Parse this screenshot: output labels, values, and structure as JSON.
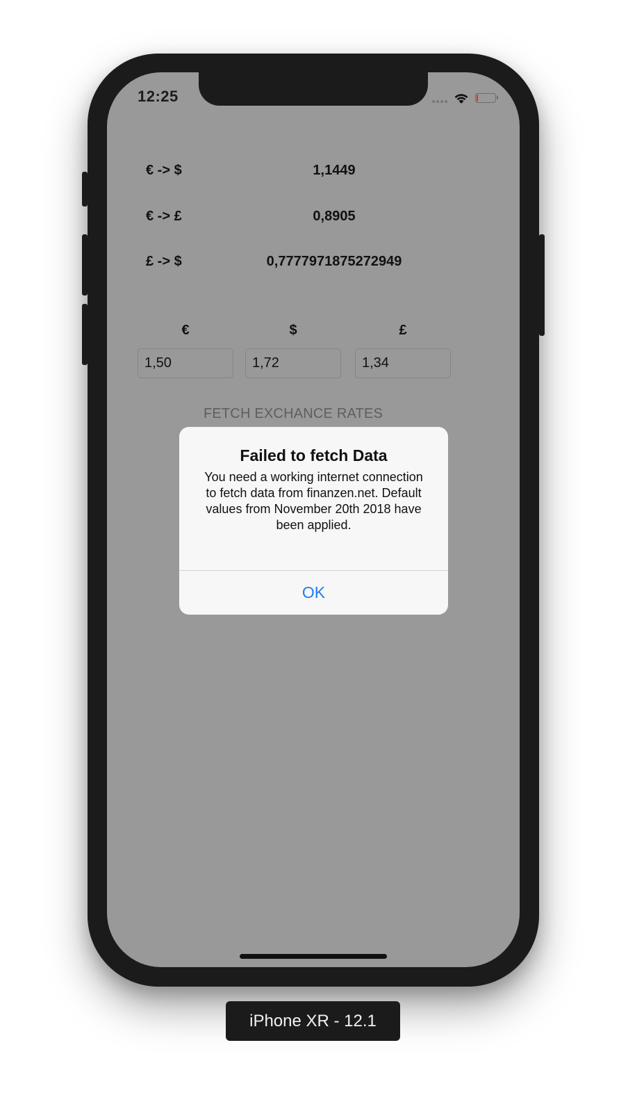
{
  "status_bar": {
    "time": "12:25"
  },
  "rates": [
    {
      "pair": "€ -> $",
      "value": "1,1449"
    },
    {
      "pair": "€ -> £",
      "value": "0,8905"
    },
    {
      "pair": "£ -> $",
      "value": "0,7777971875272949"
    }
  ],
  "converter": {
    "euro_label": "€",
    "dollar_label": "$",
    "pound_label": "£",
    "euro_value": "1,50",
    "dollar_value": "1,72",
    "pound_value": "1,34"
  },
  "fetch_button_label": "FETCH EXCHANCE RATES",
  "alert": {
    "title": "Failed to fetch Data",
    "message": "You need a working internet connection to fetch data from finanzen.net. Default values from November 20th 2018 have been applied.",
    "ok_label": "OK"
  },
  "device_label": "iPhone XR - 12.1",
  "colors": {
    "accent": "#1b7cf4",
    "screen_dim": "#999999",
    "battery_low": "#d0302a"
  },
  "icons": {
    "wifi": "wifi-icon",
    "battery": "battery-icon",
    "signal": "cellular-signal-icon"
  }
}
